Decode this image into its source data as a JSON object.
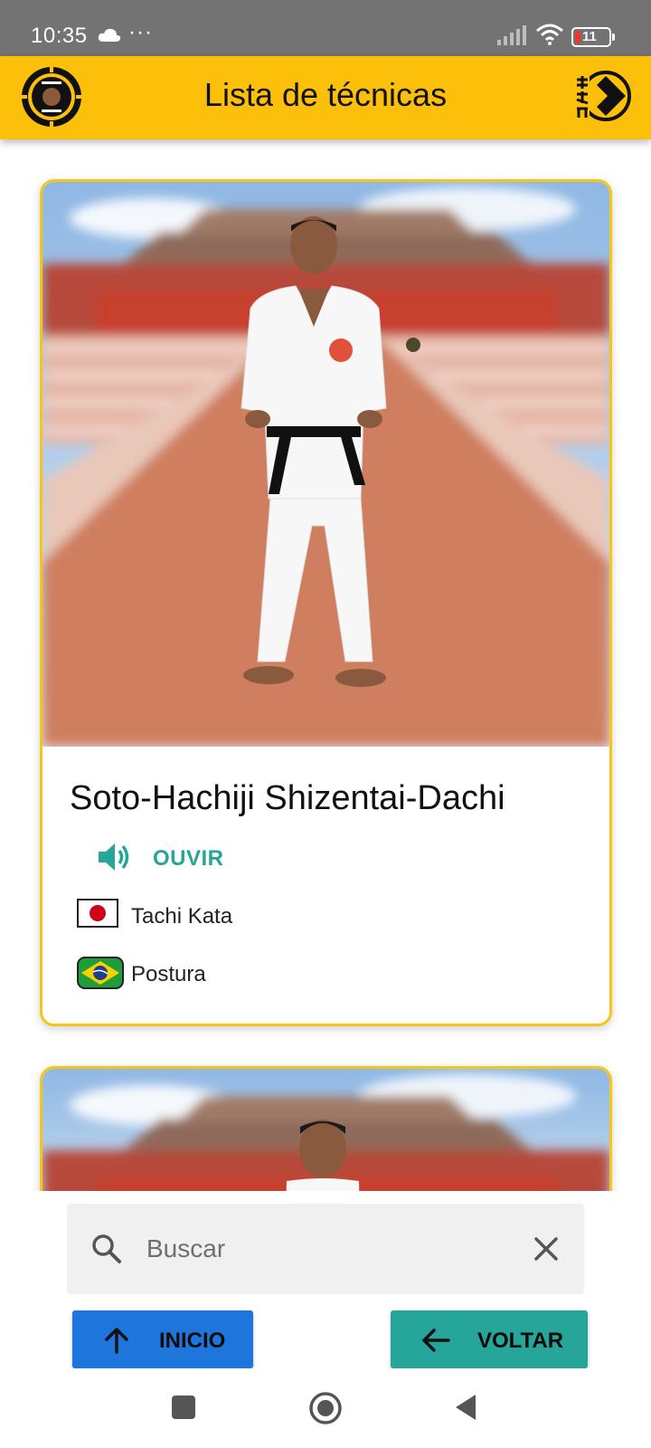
{
  "status_bar": {
    "time": "10:35",
    "more": "···",
    "battery": "11"
  },
  "app_bar": {
    "title": "Lista de técnicas"
  },
  "techniques": [
    {
      "name": "Soto-Hachiji Shizentai-Dachi",
      "listen_label": "OUVIR",
      "japanese_label": "Tachi Kata",
      "portuguese_label": "Postura"
    }
  ],
  "search": {
    "placeholder": "Buscar",
    "value": ""
  },
  "buttons": {
    "inicio": "INICIO",
    "voltar": "VOLTAR"
  },
  "colors": {
    "app_bar": "#fdc00a",
    "card_border": "#f5c518",
    "accent_teal": "#26a69a",
    "inicio_blue": "#1e76dc",
    "status_bar": "#737373"
  },
  "icons": {
    "listen": "speaker-icon",
    "search": "search-icon",
    "clear": "close-icon",
    "inicio": "arrow-up-icon",
    "voltar": "arrow-left-icon"
  }
}
